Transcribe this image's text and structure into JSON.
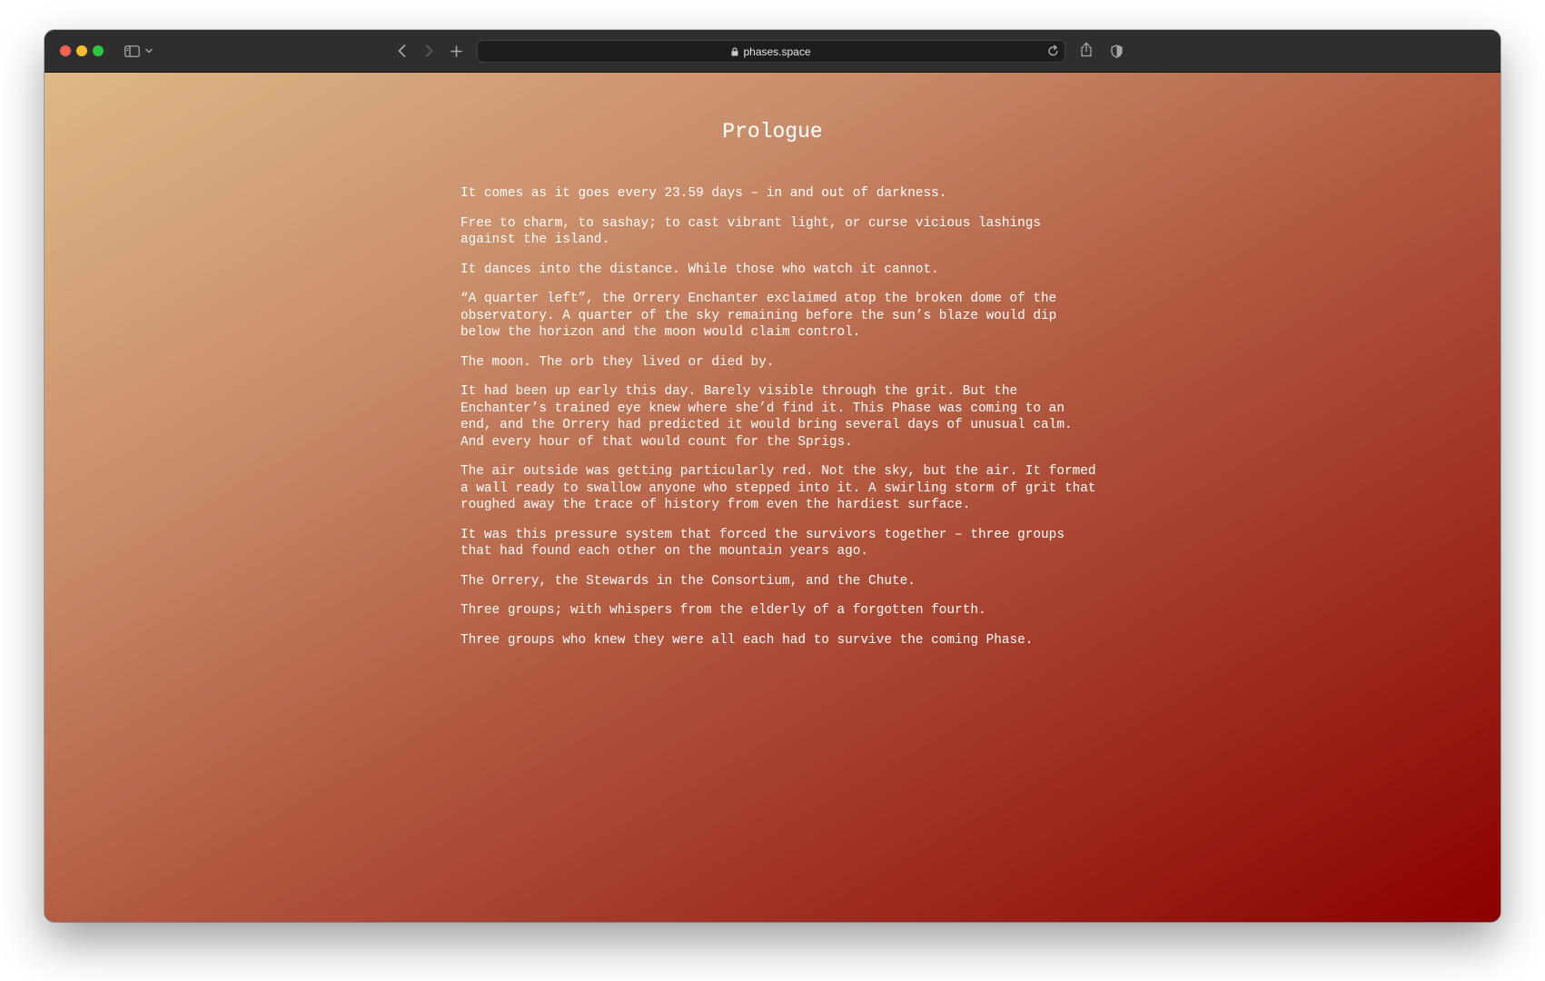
{
  "browser": {
    "url": "phases.space"
  },
  "page": {
    "title": "Prologue",
    "paragraphs": [
      "It comes as it goes every 23.59 days – in and out of darkness.",
      "Free to charm, to sashay; to cast vibrant light, or curse vicious lashings against the island.",
      "It dances into the distance. While those who watch it cannot.",
      "“A quarter left”, the Orrery Enchanter exclaimed atop the broken dome of the observatory. A quarter of the sky remaining before the sun’s blaze would dip below the horizon and the moon would claim control.",
      "The moon. The orb they lived or died by.",
      "It had been up early this day. Barely visible through the grit. But the Enchanter’s trained eye knew where she’d find it. This Phase was coming to an end, and the Orrery had predicted it would bring several days of unusual calm. And every hour of that would count for the Sprigs.",
      "The air outside was getting particularly red. Not the sky, but the air. It formed a wall ready to swallow anyone who stepped into it. A swirling storm of grit that roughed away the trace of history from even the hardiest surface.",
      "It was this pressure system that forced the survivors together – three groups that had found each other on the mountain years ago.",
      "The Orrery, the Stewards in the Consortium, and the Chute.",
      "Three groups; with whispers from the elderly of a forgotten fourth.",
      "Three groups who knew they were all each had to survive the coming Phase."
    ]
  },
  "colors": {
    "gradient_start": "#deb888",
    "gradient_end": "#8b0000",
    "text": "#ffffff"
  }
}
